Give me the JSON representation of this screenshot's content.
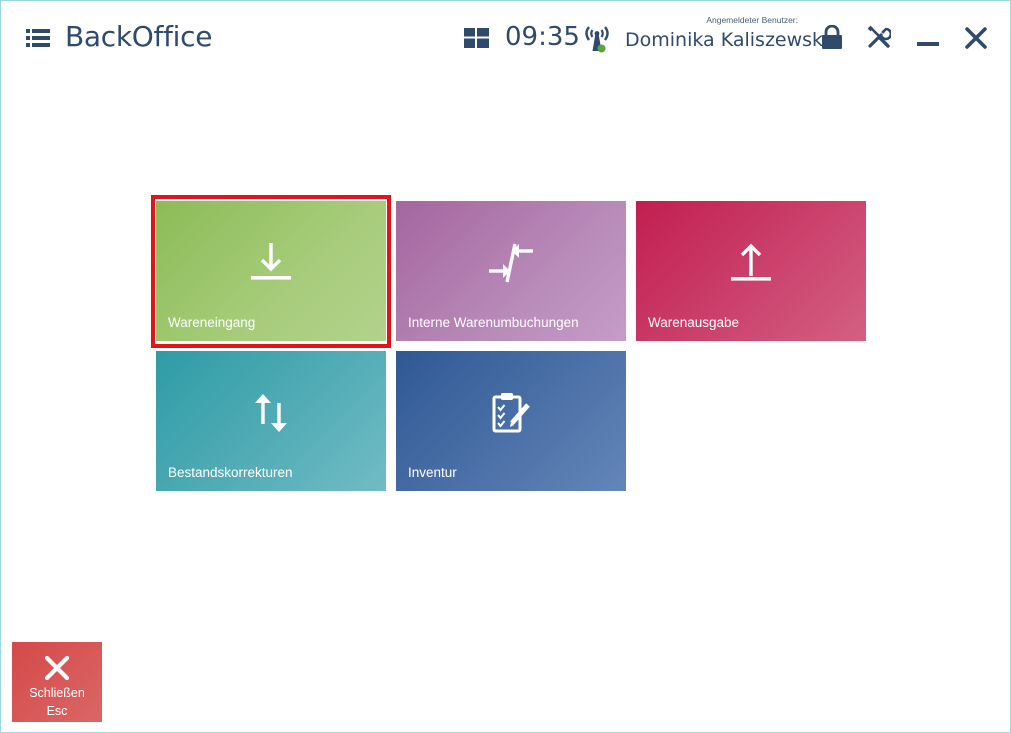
{
  "header": {
    "title": "BackOffice",
    "clock": "09:35",
    "user_label": "Angemeldeter Benutzer:",
    "user_name": "Dominika Kaliszewska"
  },
  "tiles": [
    {
      "label": "Wareneingang",
      "icon": "download-icon",
      "selected": true
    },
    {
      "label": "Interne Warenumbuchungen",
      "icon": "transfer-arrows-icon",
      "selected": false
    },
    {
      "label": "Warenausgabe",
      "icon": "upload-icon",
      "selected": false
    },
    {
      "label": "Bestandskorrekturen",
      "icon": "up-down-arrows-icon",
      "selected": false
    },
    {
      "label": "Inventur",
      "icon": "clipboard-check-icon",
      "selected": false
    }
  ],
  "close_button": {
    "label": "Schließen",
    "shortcut": "Esc"
  },
  "colors": {
    "header_text": "#2f4a6b",
    "selected_frame": "#e1141c",
    "tile_wareneingang": "#8cbc56",
    "tile_intern": "#a4669f",
    "tile_ausgabe": "#c21e50",
    "tile_bestand": "#2e9ca5",
    "tile_inventur": "#2f5994",
    "close_button": "#d44a4a"
  }
}
